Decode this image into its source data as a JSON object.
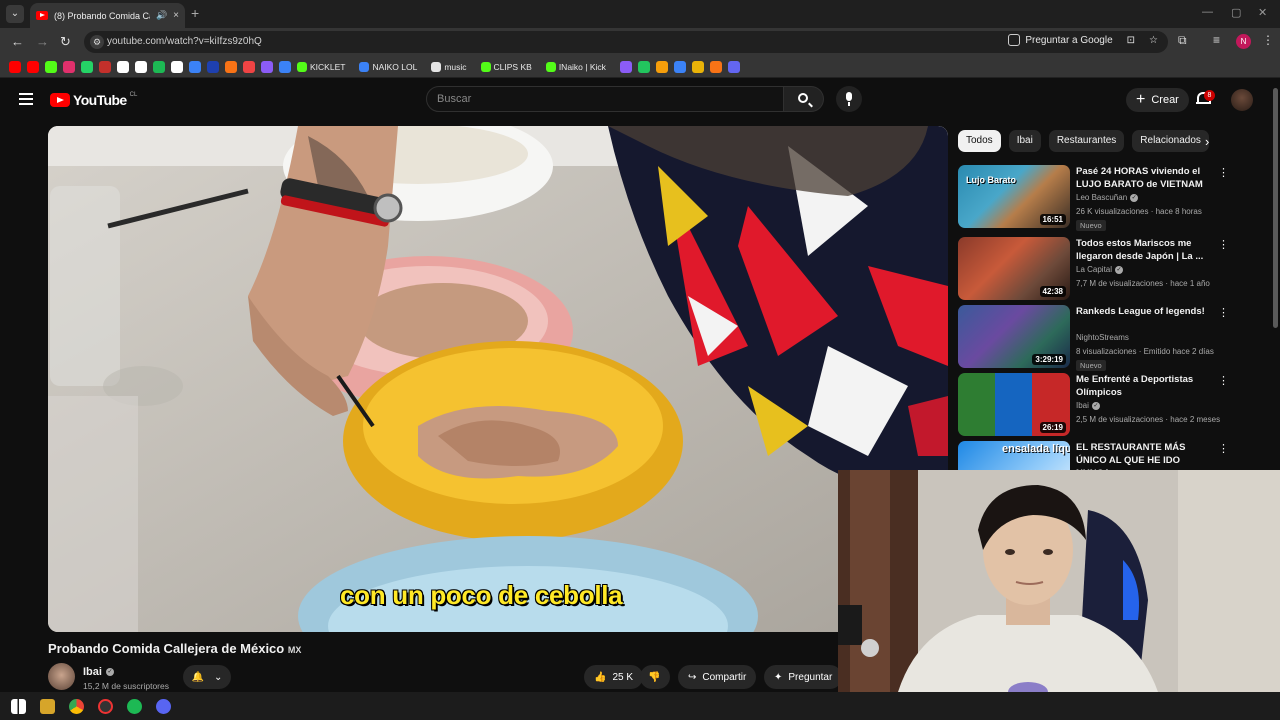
{
  "browser": {
    "tab_title": "(8) Probando Comida Calle",
    "url": "youtube.com/watch?v=kiIfzs9z0hQ",
    "ask_google": "Preguntar a Google",
    "profile_initial": "N",
    "new_tab": "+",
    "close": "×",
    "speaker": "🔊"
  },
  "bookmarks": [
    {
      "label": "KICKLET",
      "color": "#53fc18"
    },
    {
      "label": "NAIKO LOL",
      "color": "#3b82f6"
    },
    {
      "label": "music",
      "color": "#e5e5e5"
    },
    {
      "label": "CLIPS KB",
      "color": "#53fc18"
    },
    {
      "label": "INaiko | Kick",
      "color": "#53fc18"
    }
  ],
  "bookmark_icons": [
    "#ff0000",
    "#ff0000",
    "#53fc18",
    "#e1306c",
    "#25d366",
    "#c4302b",
    "#ffffff",
    "#ffffff",
    "#1db954",
    "#ffffff",
    "#3b82f6",
    "#1e40af",
    "#f97316",
    "#ef4444",
    "#8b5cf6",
    "#3b82f6"
  ],
  "youtube": {
    "logo_text": "YouTube",
    "country": "CL",
    "search_placeholder": "Buscar",
    "create_label": "Crear",
    "notifications": "8"
  },
  "video": {
    "subtitle": "con un poco de cebolla",
    "title": "Probando Comida Callejera de México",
    "flag": "MX",
    "channel": "Ibai",
    "subscribers": "15,2 M de suscriptores",
    "likes": "25 K",
    "share_label": "Compartir",
    "ask_label": "Preguntar"
  },
  "chips": [
    "Todos",
    "Ibai",
    "Restaurantes",
    "Relacionados"
  ],
  "recommendations": [
    {
      "title": "Pasé 24 HORAS viviendo el LUJO BARATO de VIETNAM",
      "channel": "Leo Bascuñan",
      "verified": true,
      "meta": "26 K visualizaciones · hace 8 horas",
      "badge": "Nuevo",
      "duration": "16:51",
      "thumb_label": "Lujo Barato"
    },
    {
      "title": "Todos estos Mariscos me llegaron desde Japón | La ...",
      "channel": "La Capital",
      "verified": true,
      "meta": "7,7 M de visualizaciones · hace 1 año",
      "badge": "",
      "duration": "42:38",
      "thumb_label": ""
    },
    {
      "title": "Rankeds League of legends!",
      "channel": "NightoStreams",
      "verified": false,
      "meta": "8 visualizaciones · Emitido hace 2 días",
      "badge": "Nuevo",
      "duration": "3:29:19",
      "thumb_label": ""
    },
    {
      "title": "Me Enfrenté a Deportistas Olímpicos",
      "channel": "Ibai",
      "verified": true,
      "meta": "2,5 M de visualizaciones · hace 2 meses",
      "badge": "",
      "duration": "26:19",
      "thumb_label": ""
    },
    {
      "title": "EL RESTAURANTE MÁS ÚNICO AL QUE HE IDO NUNCA",
      "channel": "",
      "verified": false,
      "meta": "",
      "badge": "",
      "duration": "",
      "thumb_label": "ensalada líquida"
    }
  ]
}
